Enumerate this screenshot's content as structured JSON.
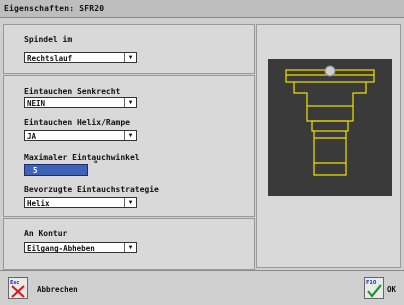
{
  "window": {
    "title": "Eigenschaften: SFR20"
  },
  "spindle": {
    "label": "Spindel im",
    "value": "Rechtslauf"
  },
  "plunge_vertical": {
    "label": "Eintauchen Senkrecht",
    "value": "NEIN"
  },
  "plunge_helix": {
    "label": "Eintauchen Helix/Rampe",
    "value": "JA"
  },
  "max_angle": {
    "label": "Maximaler Eintauchwinkel",
    "value": "5",
    "unit": "°"
  },
  "strategy": {
    "label": "Bevorzugte Eintauchstrategie",
    "value": "Helix"
  },
  "contour": {
    "label": "An Kontur",
    "value": "Eilgang-Abheben"
  },
  "footer": {
    "cancel": {
      "label": "Abbrechen",
      "icon_text": "Esc"
    },
    "ok": {
      "label": "OK",
      "icon_text": "F10"
    }
  },
  "colors": {
    "preview_bg": "#3a3a3a",
    "tool_outline": "#f2e100",
    "field_accent": "#3d63b8"
  }
}
